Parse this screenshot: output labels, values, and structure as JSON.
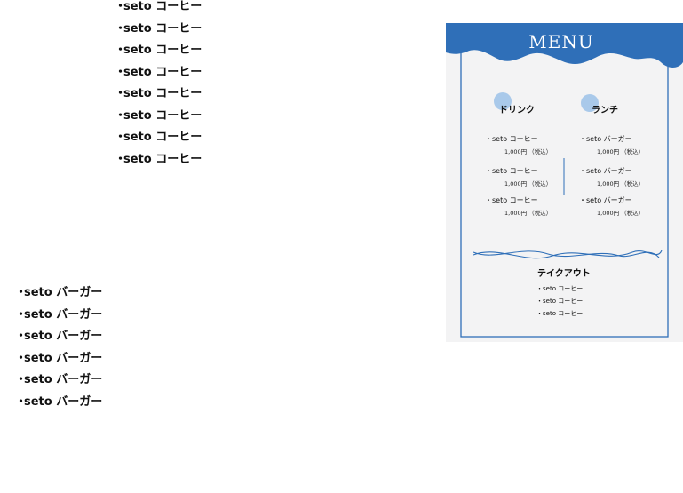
{
  "bullet": "・",
  "list_a": [
    "seto コーヒー",
    "seto コーヒー",
    "seto コーヒー",
    "seto コーヒー",
    "seto コーヒー",
    "seto コーヒー",
    "seto コーヒー",
    "seto コーヒー"
  ],
  "list_b": [
    "seto バーガー",
    "seto バーガー",
    "seto バーガー",
    "seto バーガー",
    "seto バーガー",
    "seto バーガー"
  ],
  "menu": {
    "title": "MENU",
    "drink": {
      "title": "ドリンク",
      "items": [
        {
          "name": "・seto コーヒー",
          "price": "1,000円 （税込）"
        },
        {
          "name": "・seto コーヒー",
          "price": "1,000円 （税込）"
        },
        {
          "name": "・seto コーヒー",
          "price": "1,000円 （税込）"
        }
      ]
    },
    "lunch": {
      "title": "ランチ",
      "items": [
        {
          "name": "・seto バーガー",
          "price": "1,000円 （税込）"
        },
        {
          "name": "・seto バーガー",
          "price": "1,000円 （税込）"
        },
        {
          "name": "・seto バーガー",
          "price": "1,000円 （税込）"
        }
      ]
    },
    "takeout": {
      "title": "テイクアウト",
      "items": [
        "・seto コーヒー",
        "・seto コーヒー",
        "・seto コーヒー"
      ]
    },
    "colors": {
      "accent": "#2f6fb8",
      "circle": "#a9c9ea",
      "background": "#f3f3f4"
    }
  }
}
